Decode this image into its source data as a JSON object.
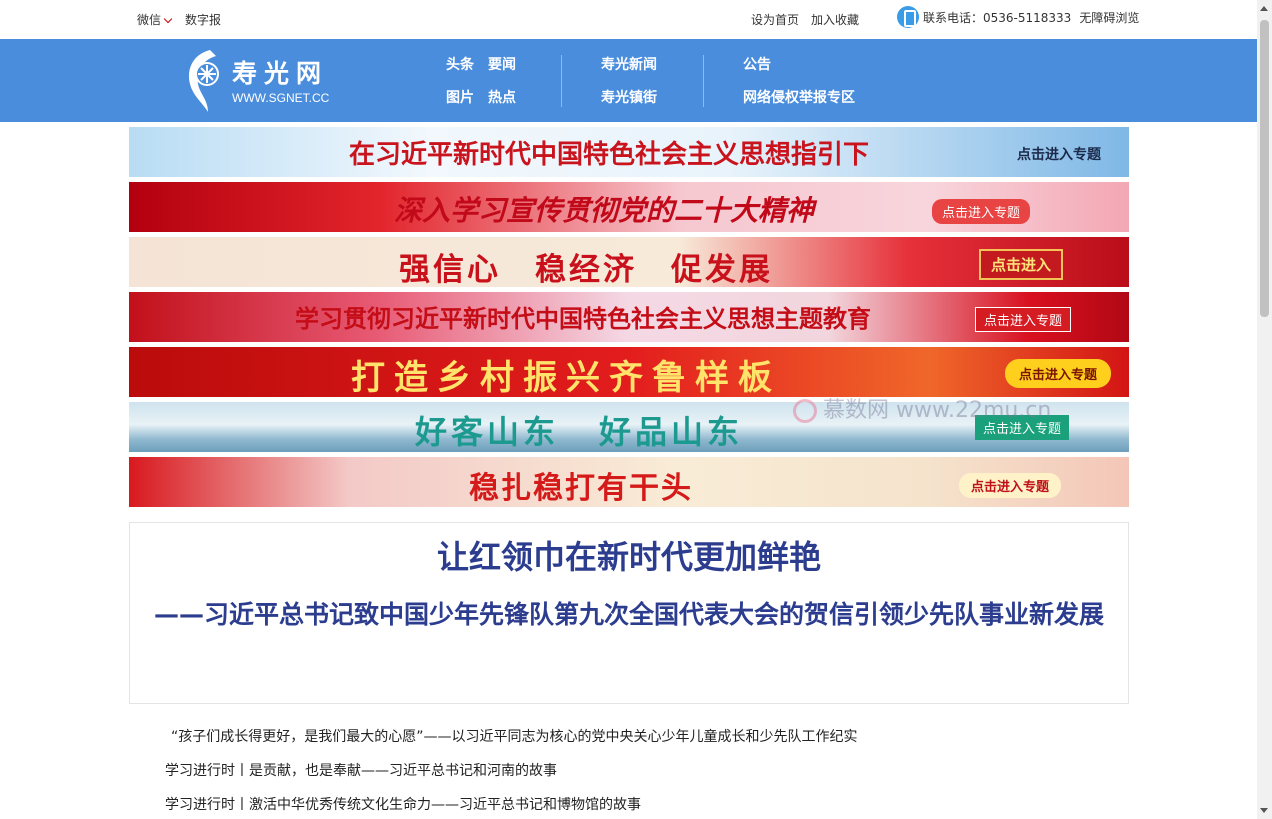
{
  "topbar": {
    "wechat": "微信",
    "digital_paper": "数字报",
    "set_home": "设为首页",
    "add_favorite": "加入收藏",
    "contact": "联系电话：0536-5118333",
    "accessibility": "无障碍浏览"
  },
  "logo": {
    "name": "寿光网",
    "domain": "WWW.SGNET.CC"
  },
  "nav": {
    "group1": {
      "row1": [
        "头条",
        "要闻"
      ],
      "row2": [
        "图片",
        "热点"
      ]
    },
    "group2": {
      "row1": [
        "寿光新闻"
      ],
      "row2": [
        "寿光镇街"
      ]
    },
    "group3": {
      "row1": [
        "公告"
      ],
      "row2": [
        "网络侵权举报专区"
      ]
    }
  },
  "banners": [
    {
      "title": "在习近平新时代中国特色社会主义思想指引下",
      "button": "点击进入专题"
    },
    {
      "title": "深入学习宣传贯彻党的二十大精神",
      "button": "点击进入专题"
    },
    {
      "title": "强信心　稳经济　促发展",
      "button": "点击进入"
    },
    {
      "title": "学习贯彻习近平新时代中国特色社会主义思想主题教育",
      "button": "点击进入专题"
    },
    {
      "title": "打造乡村振兴齐鲁样板",
      "button": "点击进入专题"
    },
    {
      "title_a": "好客山东",
      "title_b": "好品山东",
      "button": "点击进入专题"
    },
    {
      "title": "稳扎稳打有干头",
      "button": "点击进入专题"
    }
  ],
  "watermark": "慕数网 www.22mu.cn",
  "headline": {
    "title": "让红领巾在新时代更加鲜艳",
    "subtitle": "——习近平总书记致中国少年先锋队第九次全国代表大会的贺信引领少先队事业新发展"
  },
  "news": [
    "“孩子们成长得更好，是我们最大的心愿”——以习近平同志为核心的党中央关心少年儿童成长和少先队工作纪实",
    "学习进行时丨是贡献，也是奉献——习近平总书记和河南的故事",
    "学习进行时丨激活中华优秀传统文化生命力——习近平总书记和博物馆的故事"
  ],
  "colors": {
    "nav_bg": "#4a8ddc",
    "headline": "#2c3d8f",
    "accent_red": "#c9141d"
  }
}
